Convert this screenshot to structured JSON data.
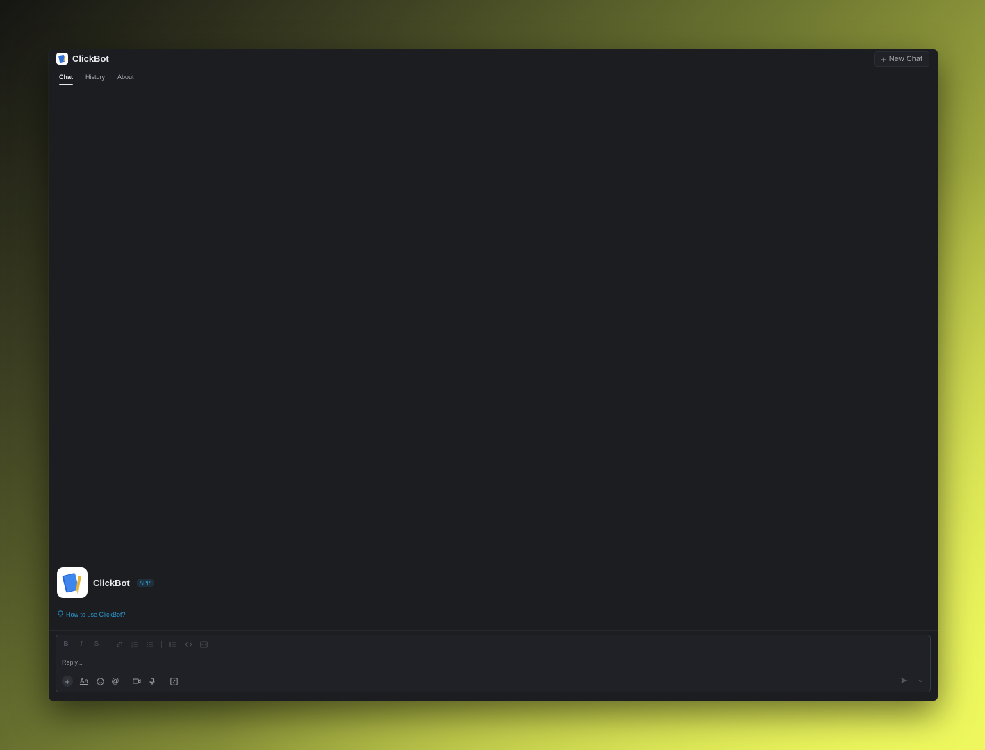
{
  "app": {
    "title": "ClickBot",
    "new_chat_label": "New Chat",
    "accent_color": "#2a98cf",
    "tabs": [
      {
        "label": "Chat",
        "active": true
      },
      {
        "label": "History",
        "active": false
      },
      {
        "label": "About",
        "active": false
      }
    ]
  },
  "bot": {
    "name": "ClickBot",
    "badge": "APP",
    "help_link": "How to use ClickBot?"
  },
  "composer": {
    "placeholder": "Reply...",
    "value": "",
    "format_buttons": [
      "bold-icon",
      "italic-icon",
      "strikethrough-icon",
      "link-icon",
      "ordered-list-icon",
      "bulleted-list-icon",
      "blockquote-icon",
      "code-icon",
      "code-block-icon"
    ],
    "action_buttons": [
      "plus-icon",
      "text-format-icon",
      "emoji-icon",
      "mention-icon",
      "video-icon",
      "microphone-icon",
      "slash-command-icon"
    ],
    "text_format_label": "Aa",
    "mention_label": "@"
  }
}
